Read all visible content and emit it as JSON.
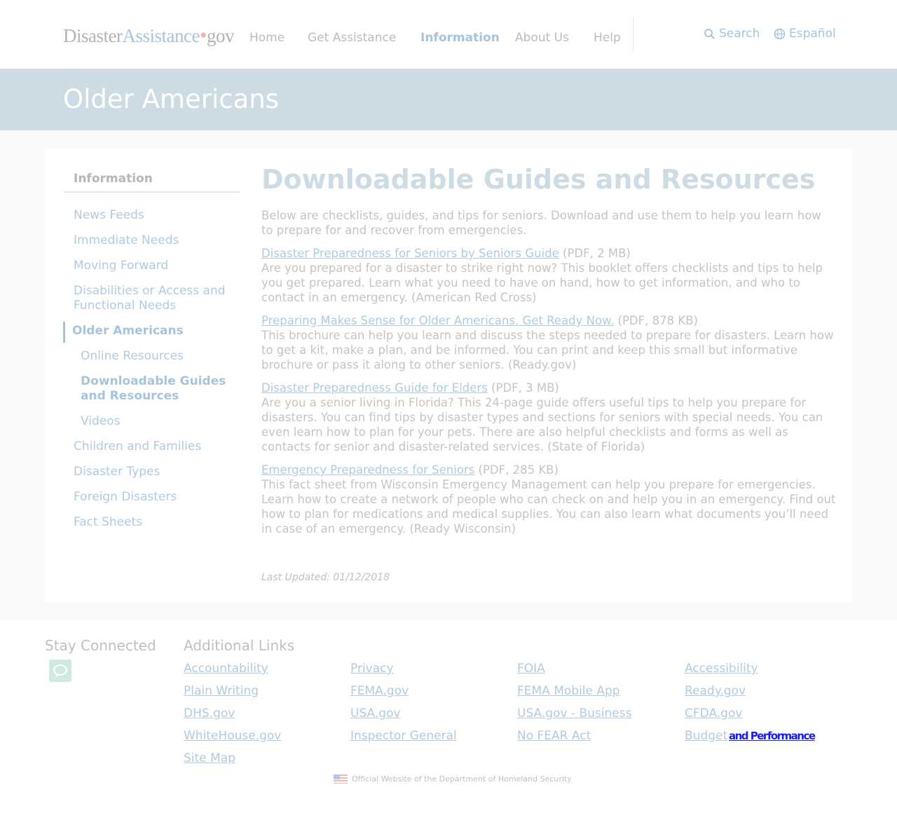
{
  "logo": {
    "part1": "Disaster",
    "part2": "Assistance",
    "dot": "•",
    "part3": "gov"
  },
  "nav": [
    {
      "label": "Home"
    },
    {
      "label": "Get Assistance"
    },
    {
      "label": "Information",
      "active": true
    },
    {
      "label": "About Us"
    },
    {
      "label": "Help"
    }
  ],
  "utility": {
    "search_label": "Search",
    "language_label": "Español"
  },
  "banner": {
    "title": "Older Americans"
  },
  "sidenav": {
    "title": "Information",
    "items": [
      {
        "label": "News Feeds"
      },
      {
        "label": "Immediate Needs"
      },
      {
        "label": "Moving Forward"
      },
      {
        "label": "Disabilities or Access and Functional Needs"
      },
      {
        "label": "Older Americans",
        "current": true
      },
      {
        "label": "Online Resources",
        "sub": true
      },
      {
        "label": "Downloadable Guides and Resources",
        "sub": true,
        "current": true
      },
      {
        "label": "Videos",
        "sub": true
      },
      {
        "label": "Children and Families"
      },
      {
        "label": "Disaster Types"
      },
      {
        "label": "Foreign Disasters"
      },
      {
        "label": "Fact Sheets"
      }
    ]
  },
  "content": {
    "heading": "Downloadable Guides and Resources",
    "intro": "Below are checklists, guides, and tips for seniors. Download and use them to help you learn how to prepare for and recover from emergencies.",
    "resources": [
      {
        "title": "Disaster Preparedness for Seniors by Seniors Guide",
        "meta": " (PDF, 2 MB)",
        "description": "Are you prepared for a disaster to strike right now? This booklet offers checklists and tips to help you get prepared. Learn what you need to have on hand, how to get information, and who to contact in an emergency. (American Red Cross)"
      },
      {
        "title": "Preparing Makes Sense for Older Americans. Get Ready Now.",
        "meta": " (PDF, 878 KB)",
        "description": "This brochure can help you learn and discuss the steps needed to prepare for disasters. Learn how to get a kit, make a plan, and be informed. You can print and keep this small but informative brochure or pass it along to other seniors. (Ready.gov)"
      },
      {
        "title": "Disaster Preparedness Guide for Elders",
        "meta": " (PDF, 3 MB)",
        "description": "Are you a senior living in Florida? This 24-page guide offers useful tips to help you prepare for disasters. You can find tips by disaster types and sections for seniors with special needs. You can even learn how to plan for your pets. There are also helpful checklists and forms as well as contacts for senior and disaster-related services. (State of Florida)"
      },
      {
        "title": "Emergency Preparedness for Seniors",
        "meta": " (PDF, 285 KB)",
        "description": "This fact sheet from Wisconsin Emergency Management can help you prepare for emergencies. Learn how to create a network of people who can check on and help you in an emergency. Find out how to plan for medications and medical supplies. You can also learn what documents you’ll need in case of an emergency. (Ready Wisconsin)"
      }
    ],
    "last_updated": "Last Updated: 01/12/2018"
  },
  "footer": {
    "stay_connected": "Stay Connected",
    "additional_links": "Additional Links",
    "links": [
      "Accountability",
      "Privacy",
      "FOIA",
      "Accessibility",
      "Plain Writing",
      "FEMA.gov",
      "FEMA Mobile App",
      "Ready.gov",
      "DHS.gov",
      "USA.gov",
      "USA.gov - Business",
      "CFDA.gov",
      "WhiteHouse.gov",
      "Inspector General",
      "No FEAR Act",
      "Budget",
      "Site Map"
    ],
    "budget_overlay": "and Performance",
    "official": "Official Website of the Department of Homeland Security"
  },
  "colors": {
    "accent": "#a8c4db",
    "banner": "#cddbe5",
    "link": "#b0cbe0"
  },
  "icons": {
    "search": "search-icon",
    "globe": "globe-icon",
    "chat": "chat-icon",
    "flag": "us-flag-icon"
  }
}
